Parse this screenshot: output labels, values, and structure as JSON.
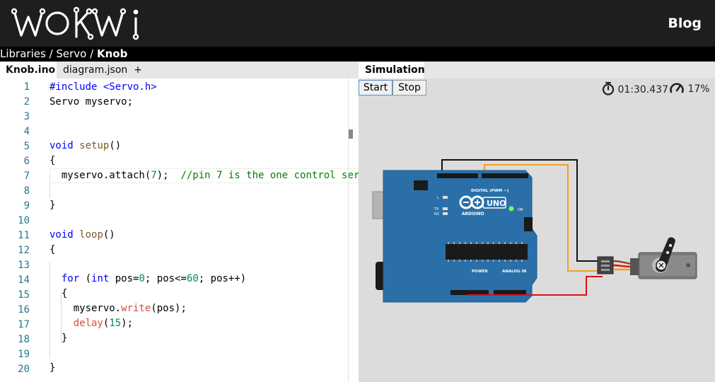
{
  "header": {
    "logo_text": "WOKWi",
    "blog_label": "Blog"
  },
  "breadcrumb": {
    "items": [
      "Libraries",
      "Servo"
    ],
    "separator": " / ",
    "current": "Knob"
  },
  "tabs": [
    {
      "label": "Knob.ino",
      "active": true
    },
    {
      "label": "diagram.json",
      "active": false
    },
    {
      "label": "+",
      "active": false
    }
  ],
  "editor": {
    "line_numbers": [
      "1",
      "2",
      "3",
      "4",
      "5",
      "6",
      "7",
      "8",
      "9",
      "10",
      "11",
      "12",
      "13",
      "14",
      "15",
      "16",
      "17",
      "18",
      "19",
      "20"
    ],
    "comment_text": "//pin 7 is the one control ser"
  },
  "simulation": {
    "tab_label": "Simulation",
    "start_label": "Start",
    "stop_label": "Stop",
    "timer": "01:30.437",
    "speed": "17%",
    "icons": {
      "timer": "stopwatch-icon",
      "speed": "speedometer-icon"
    },
    "board_labels": {
      "uno": "UNO",
      "arduino": "ARDUINO",
      "digital": "DIGITAL (PWM ~)",
      "power": "POWER",
      "analog": "ANALOG IN",
      "on": "ON",
      "l": "L",
      "tx": "TX",
      "rx": "RX"
    }
  },
  "colors": {
    "board": "#2a6fa8",
    "wire_signal": "#f0a020",
    "wire_power": "#e01010",
    "wire_gnd": "#111111"
  }
}
